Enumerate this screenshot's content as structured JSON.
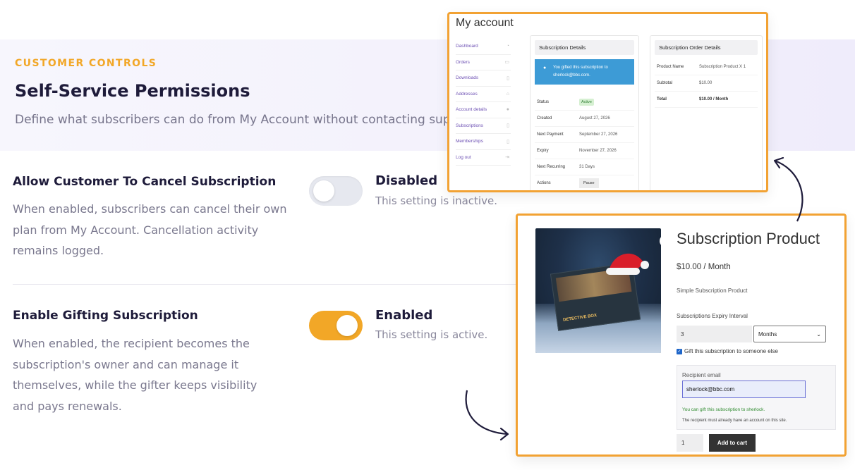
{
  "hero": {
    "eyebrow": "CUSTOMER CONTROLS",
    "title": "Self-Service Permissions",
    "subtitle": "Define what subscribers can do from My Account without contacting support."
  },
  "settings": [
    {
      "title": "Allow Customer To Cancel Subscription",
      "description": "When enabled, subscribers can cancel their own plan from My Account. Cancellation activity remains logged.",
      "enabled": false,
      "state_label": "Disabled",
      "state_note": "This setting is inactive."
    },
    {
      "title": "Enable Gifting Subscription",
      "description": "When enabled, the recipient becomes the subscription's owner and can manage it themselves, while the gifter keeps visibility and pays renewals.",
      "enabled": true,
      "state_label": "Enabled",
      "state_note": "This setting is active."
    }
  ],
  "account": {
    "title": "My account",
    "nav": [
      "Dashboard",
      "Orders",
      "Downloads",
      "Addresses",
      "Account details",
      "Subscriptions",
      "Memberships",
      "Log out"
    ],
    "details_title": "Subscription Details",
    "notice": "You gifted this subscription to sherlock@bbc.com.",
    "rows": [
      {
        "key": "Status",
        "value": "Active"
      },
      {
        "key": "Created",
        "value": "August 27, 2026"
      },
      {
        "key": "Next Payment",
        "value": "September 27, 2026"
      },
      {
        "key": "Expiry",
        "value": "November 27, 2026"
      },
      {
        "key": "Next Recurring",
        "value": "31 Days"
      },
      {
        "key": "Actions",
        "value": "Pause"
      }
    ],
    "order_title": "Subscription Order Details",
    "order_rows": [
      {
        "key": "Product Name",
        "value": "Subscription Product X 1"
      },
      {
        "key": "Subtotal",
        "value": "$10.00"
      },
      {
        "key": "Total",
        "value": "$10.00 / Month"
      }
    ]
  },
  "product": {
    "title": "Subscription Product",
    "price": "$10.00 / Month",
    "description": "Simple Subscription Product",
    "interval_label": "Subscriptions Expiry Interval",
    "interval_value": "3",
    "interval_unit": "Months",
    "gift_label": "Gift this subscription to someone else",
    "recipient_label": "Recipient email",
    "recipient_email": "sherlock@bbc.com",
    "ok_message": "You can gift this subscription to sherlock.",
    "help_message": "The recipient must already have an account on this site.",
    "quantity": "1",
    "add_to_cart": "Add to cart",
    "box_text": "DETECTIVE BOX"
  }
}
